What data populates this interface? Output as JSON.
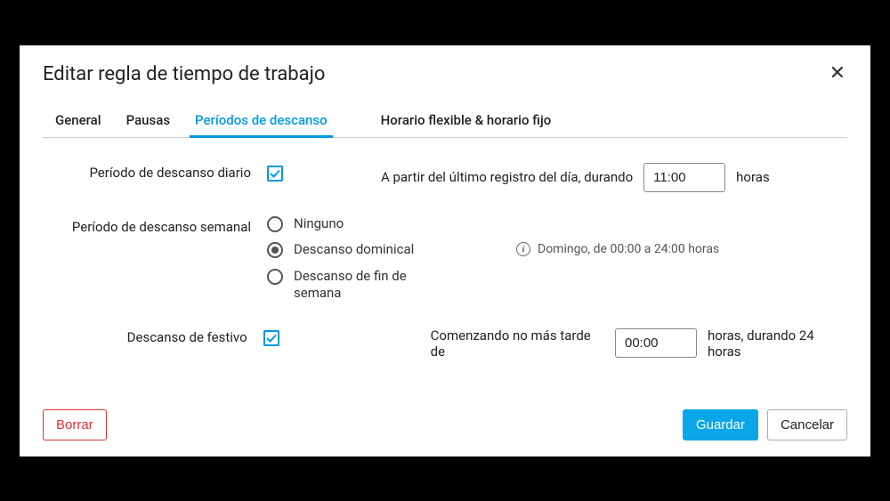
{
  "modal": {
    "title": "Editar regla de tiempo de trabajo",
    "close_glyph": "✕"
  },
  "tabs": {
    "general": "General",
    "pausas": "Pausas",
    "periodos": "Períodos de descanso",
    "horario": "Horario flexible & horario fijo"
  },
  "daily": {
    "label": "Período de descanso diario",
    "checked": true,
    "text_before": "A partir del último registro del día, durando",
    "value": "11:00",
    "text_after": "horas"
  },
  "weekly": {
    "label": "Período de descanso semanal",
    "options": {
      "none": "Ninguno",
      "sunday": "Descanso dominical",
      "weekend": "Descanso de fin de semana"
    },
    "selected": "sunday",
    "info": "Domingo, de 00:00 a 24:00 horas",
    "info_glyph": "i"
  },
  "holiday": {
    "label": "Descanso de festivo",
    "checked": true,
    "text_before": "Comenzando no más tarde de",
    "value": "00:00",
    "text_after": "horas, durando 24 horas"
  },
  "footer": {
    "delete": "Borrar",
    "save": "Guardar",
    "cancel": "Cancelar"
  }
}
